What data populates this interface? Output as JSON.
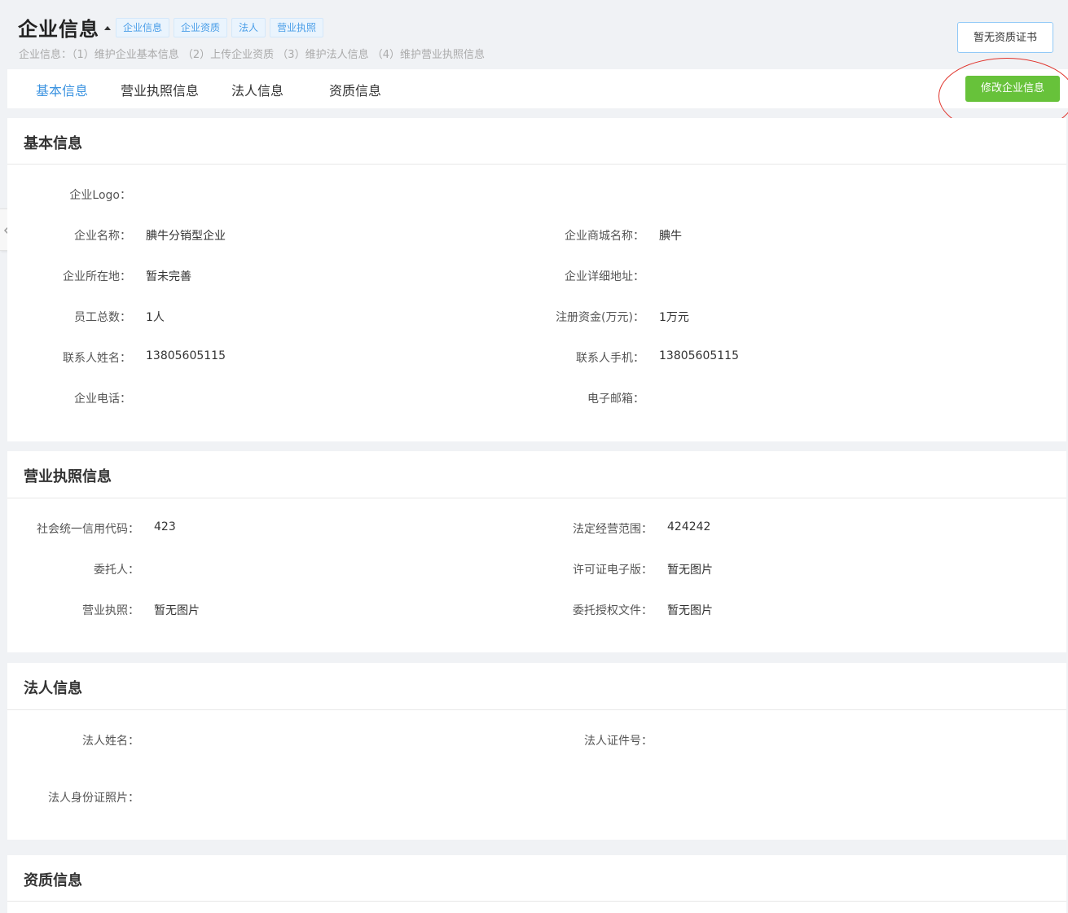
{
  "header": {
    "title": "企业信息",
    "tags": [
      "企业信息",
      "企业资质",
      "法人",
      "营业执照"
    ],
    "subtitle": "企业信息：（1）维护企业基本信息 （2）上传企业资质 （3）维护法人信息 （4）维护营业执照信息",
    "cert_button": "暂无资质证书"
  },
  "tabs": [
    "基本信息",
    "营业执照信息",
    "法人信息",
    "资质信息"
  ],
  "active_tab": "基本信息",
  "edit_button": "修改企业信息",
  "basic": {
    "title": "基本信息",
    "logo_label": "企业Logo：",
    "name_label": "企业名称：",
    "name_value": "腆牛分销型企业",
    "mall_name_label": "企业商城名称：",
    "mall_name_value": "腆牛",
    "location_label": "企业所在地：",
    "location_value": "暂未完善",
    "address_label": "企业详细地址：",
    "address_value": "",
    "employees_label": "员工总数：",
    "employees_value": "1人",
    "capital_label": "注册资金(万元)：",
    "capital_value": "1万元",
    "contact_name_label": "联系人姓名：",
    "contact_name_value": "13805605115",
    "contact_phone_label": "联系人手机：",
    "contact_phone_value": "13805605115",
    "tel_label": "企业电话：",
    "tel_value": "",
    "email_label": "电子邮箱：",
    "email_value": ""
  },
  "license": {
    "title": "营业执照信息",
    "credit_code_label": "社会统一信用代码：",
    "credit_code_value": "423",
    "scope_label": "法定经营范围：",
    "scope_value": "424242",
    "trustee_label": "委托人：",
    "trustee_value": "",
    "permit_label": "许可证电子版：",
    "permit_value": "暂无图片",
    "license_label": "营业执照：",
    "license_value": "暂无图片",
    "authorization_label": "委托授权文件：",
    "authorization_value": "暂无图片"
  },
  "legal": {
    "title": "法人信息",
    "name_label": "法人姓名：",
    "name_value": "",
    "id_no_label": "法人证件号：",
    "id_no_value": "",
    "id_photo_label": "法人身份证照片："
  },
  "qualification": {
    "title": "资质信息"
  },
  "colors": {
    "accent_blue": "#3b93e0",
    "edit_green": "#67c23a",
    "annotation_red": "#e0332b",
    "page_bg": "#f0f2f5"
  }
}
